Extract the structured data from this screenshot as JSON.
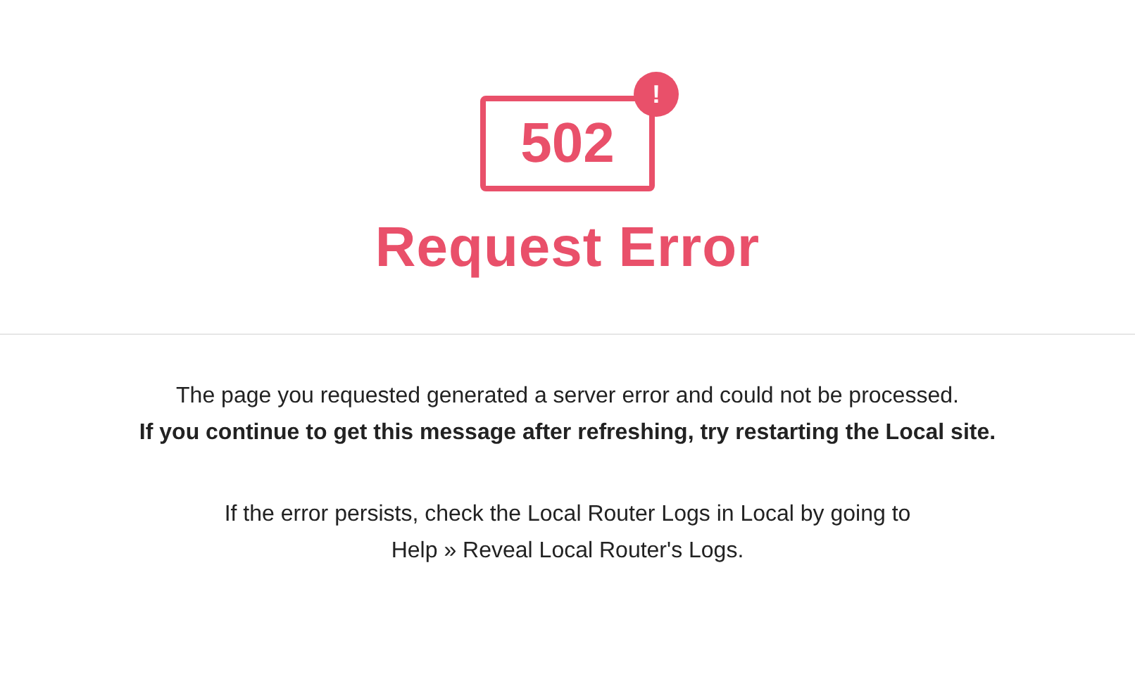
{
  "header": {
    "code": "502",
    "badge": "!",
    "title": "Request Error"
  },
  "messages": [
    {
      "text": "The page you requested generated a server error and could not be processed.",
      "bold": false
    },
    {
      "text": "If you continue to get this message after refreshing, try restarting the Local site.",
      "bold": true
    }
  ],
  "help": [
    "If the error persists, check the Local Router Logs in Local by going to",
    "Help » Reveal Local Router's Logs."
  ]
}
